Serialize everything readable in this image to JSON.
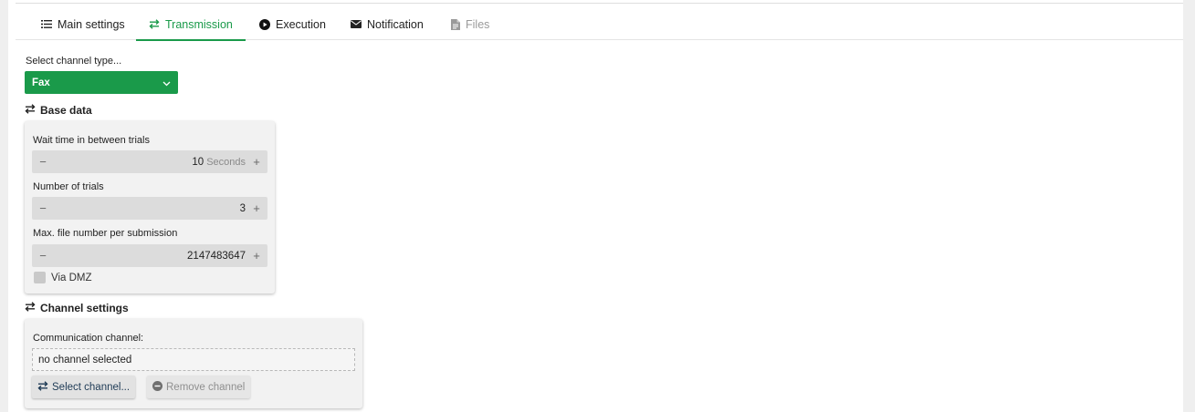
{
  "tabs": [
    {
      "label": "Main settings",
      "icon": "list-icon",
      "state": "normal"
    },
    {
      "label": "Transmission",
      "icon": "transfer-arrows-icon",
      "state": "active"
    },
    {
      "label": "Execution",
      "icon": "play-circle-icon",
      "state": "normal"
    },
    {
      "label": "Notification",
      "icon": "envelope-icon",
      "state": "normal"
    },
    {
      "label": "Files",
      "icon": "file-icon",
      "state": "disabled"
    }
  ],
  "channel_type": {
    "label": "Select channel type...",
    "selected": "Fax"
  },
  "base_data": {
    "title": "Base data",
    "wait_time": {
      "label": "Wait time in between trials",
      "value": "10",
      "unit": "Seconds"
    },
    "num_trials": {
      "label": "Number of trials",
      "value": "3"
    },
    "max_files": {
      "label": "Max. file number per submission",
      "value": "2147483647"
    },
    "via_dmz": {
      "label": "Via DMZ",
      "checked": false
    }
  },
  "channel_settings": {
    "title": "Channel settings",
    "comm_label": "Communication channel:",
    "comm_value": "no channel selected",
    "select_button": "Select channel...",
    "remove_button": "Remove channel"
  },
  "colors": {
    "accent": "#1a9a4a",
    "panel_bg": "#f2f2f2",
    "stepper_bg": "#dcdcdc"
  }
}
